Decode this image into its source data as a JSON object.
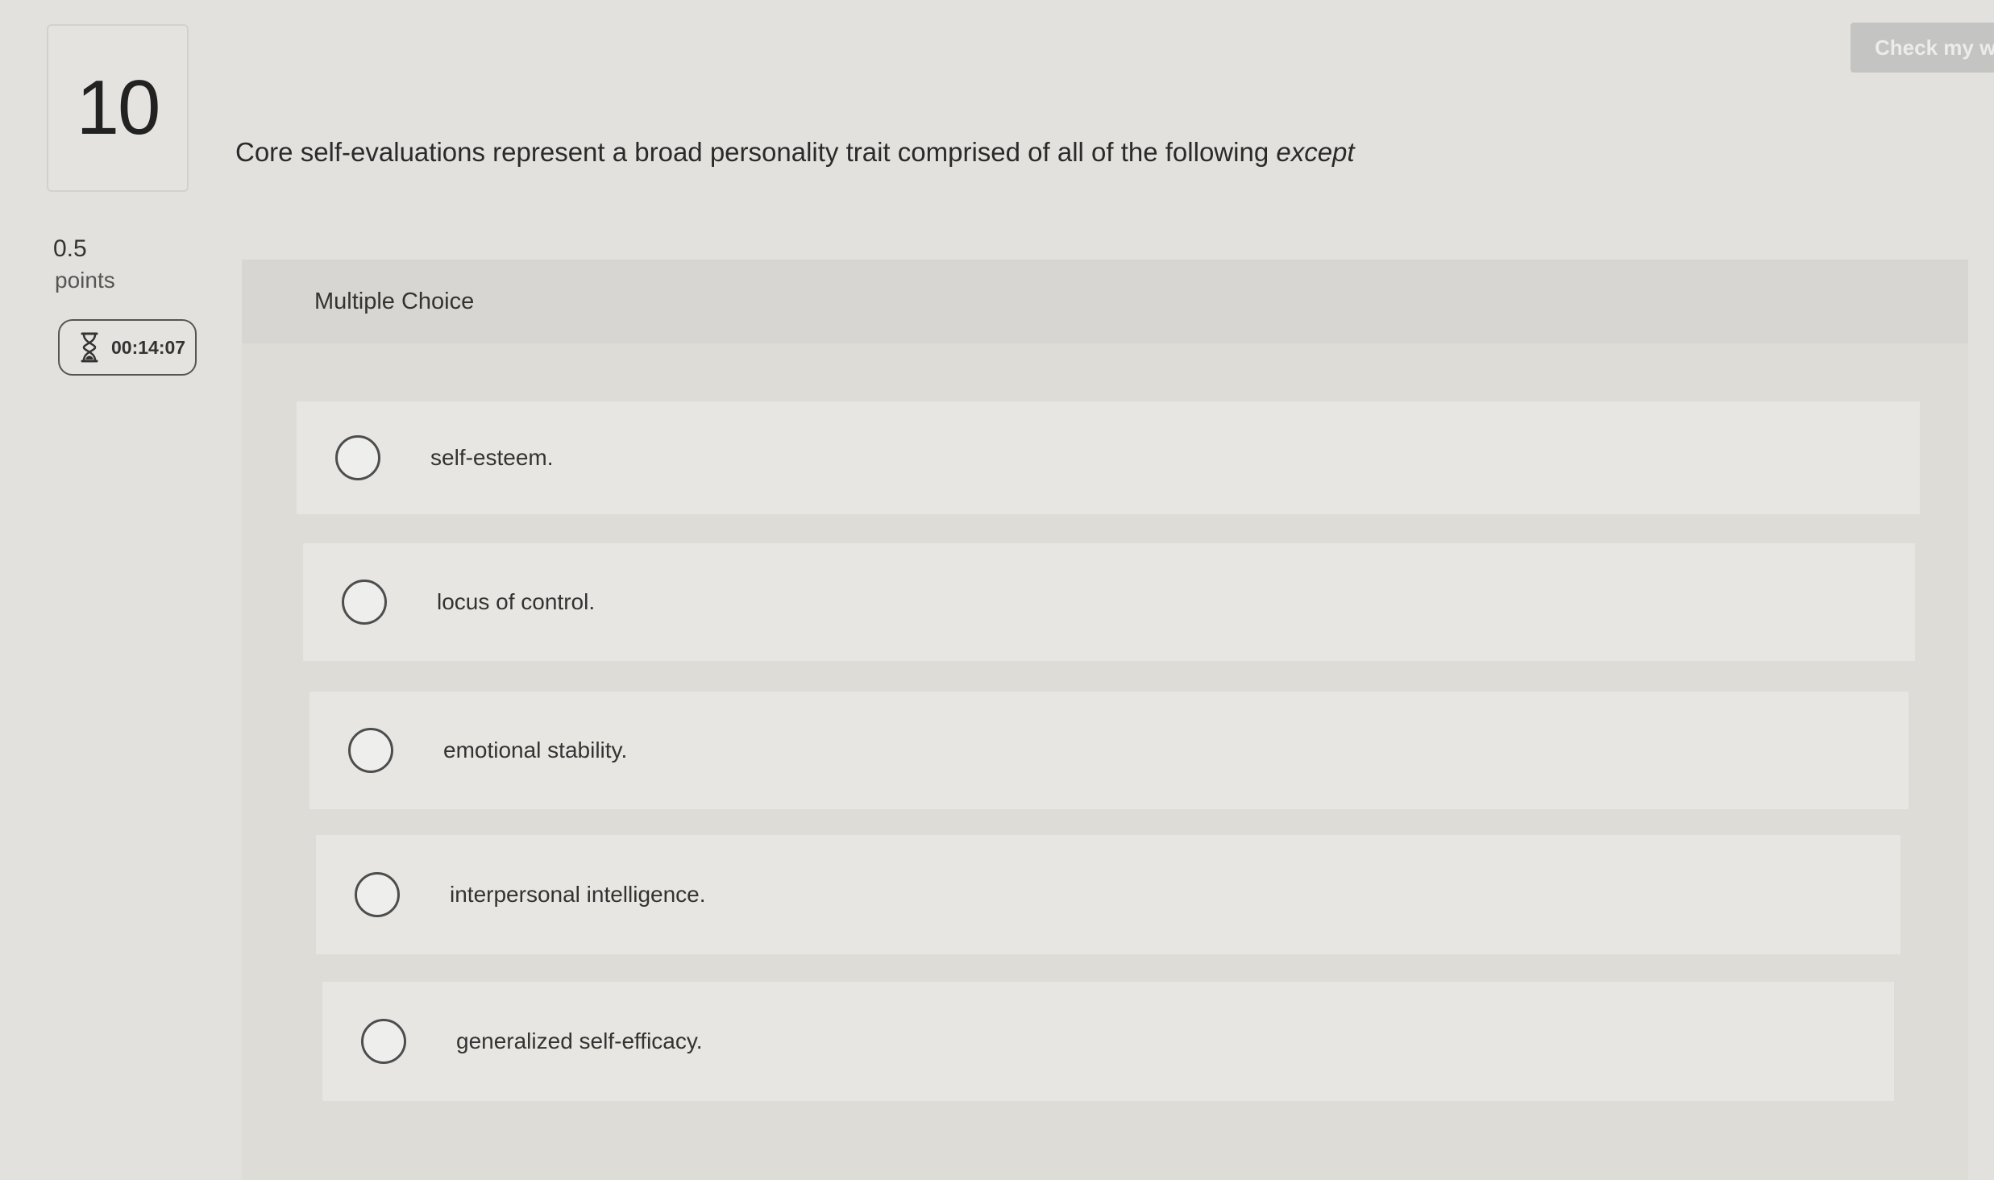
{
  "question_number": "10",
  "points": {
    "value": "0.5",
    "label": "points"
  },
  "timer": {
    "icon": "hourglass-icon",
    "value": "00:14:07"
  },
  "header": {
    "check_button_label": "Check my w"
  },
  "question": {
    "text": "Core self-evaluations represent a broad personality trait comprised of all of the following",
    "emphasis": "except"
  },
  "answer_panel": {
    "type_label": "Multiple Choice",
    "options": [
      {
        "label": "self-esteem."
      },
      {
        "label": "locus of control."
      },
      {
        "label": "emotional stability."
      },
      {
        "label": "interpersonal intelligence."
      },
      {
        "label": "generalized self-efficacy."
      }
    ]
  },
  "colors": {
    "background": "#e2e1dd",
    "panel": "#dedcd7",
    "option_background": "#e7e6e2",
    "check_button": "#c4c4c2"
  }
}
